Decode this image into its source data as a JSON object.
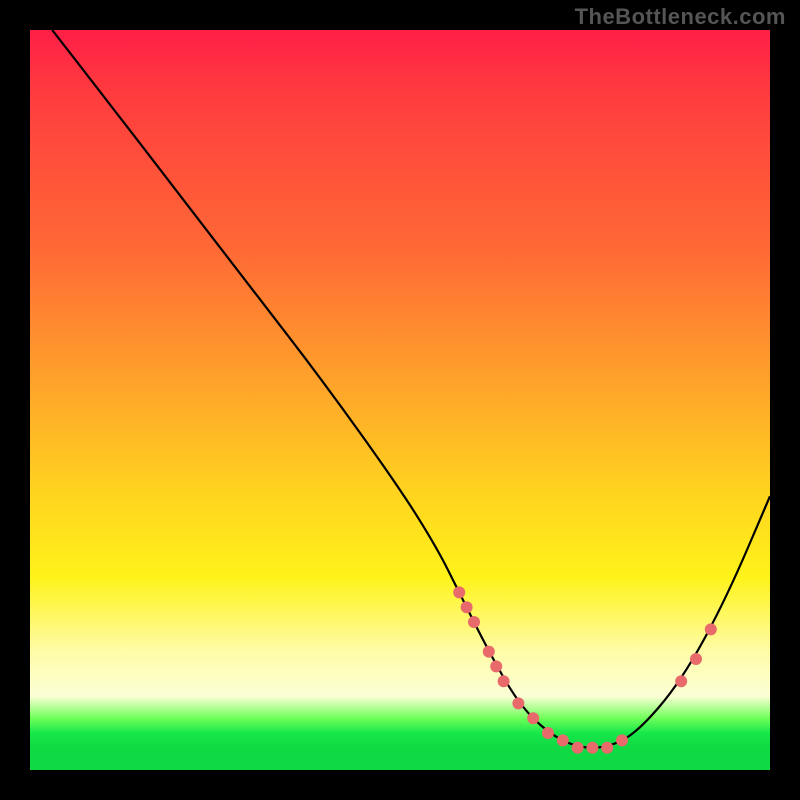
{
  "watermark": "TheBottleneck.com",
  "chart_data": {
    "type": "line",
    "title": "",
    "xlabel": "",
    "ylabel": "",
    "xlim": [
      0,
      100
    ],
    "ylim": [
      0,
      100
    ],
    "series": [
      {
        "name": "curve",
        "x": [
          3,
          10,
          20,
          30,
          40,
          50,
          55,
          58,
          62,
          66,
          70,
          74,
          78,
          82,
          88,
          94,
          100
        ],
        "y": [
          100,
          91,
          78,
          65,
          52,
          38,
          30,
          24,
          16,
          9,
          5,
          3,
          3,
          5,
          12,
          23,
          37
        ]
      }
    ],
    "markers": [
      {
        "x": 58,
        "y": 24
      },
      {
        "x": 59,
        "y": 22
      },
      {
        "x": 60,
        "y": 20
      },
      {
        "x": 62,
        "y": 16
      },
      {
        "x": 63,
        "y": 14
      },
      {
        "x": 64,
        "y": 12
      },
      {
        "x": 66,
        "y": 9
      },
      {
        "x": 68,
        "y": 7
      },
      {
        "x": 70,
        "y": 5
      },
      {
        "x": 72,
        "y": 4
      },
      {
        "x": 74,
        "y": 3
      },
      {
        "x": 76,
        "y": 3
      },
      {
        "x": 78,
        "y": 3
      },
      {
        "x": 80,
        "y": 4
      },
      {
        "x": 88,
        "y": 12
      },
      {
        "x": 90,
        "y": 15
      },
      {
        "x": 92,
        "y": 19
      }
    ],
    "gradient_bands": [
      {
        "color": "#ff1f47",
        "stop": 0
      },
      {
        "color": "#ffa42a",
        "stop": 48
      },
      {
        "color": "#fff31a",
        "stop": 74
      },
      {
        "color": "#0fd943",
        "stop": 97
      }
    ]
  }
}
